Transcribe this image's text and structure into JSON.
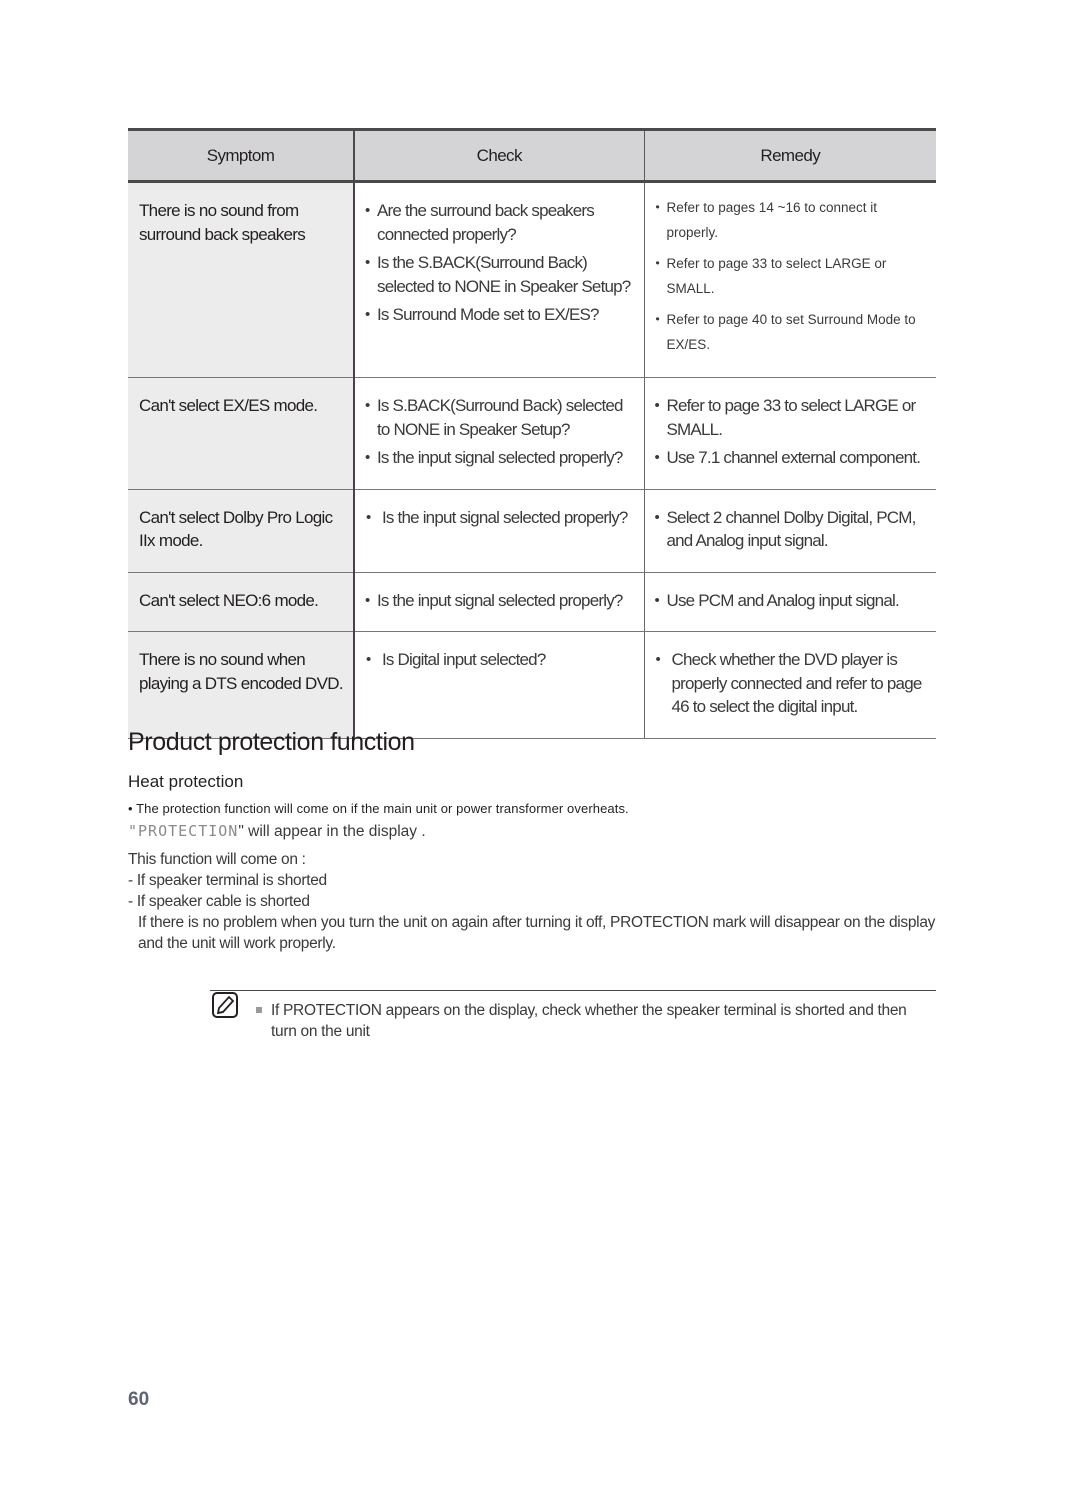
{
  "table": {
    "headers": [
      "Symptom",
      "Check",
      "Remedy"
    ],
    "rows": [
      {
        "symptom": "There is no sound from surround back speakers",
        "checks": [
          "Are the surround back speakers connected properly?",
          "Is the S.BACK(Surround Back) selected to NONE in Speaker Setup?",
          "Is Surround Mode set to EX/ES?"
        ],
        "remedies": [
          "Refer to pages 14 ~16 to connect it properly.",
          "Refer to page 33 to select LARGE or SMALL.",
          "Refer to page 40 to set Surround Mode to EX/ES."
        ]
      },
      {
        "symptom": "Can't select EX/ES mode.",
        "checks": [
          "Is S.BACK(Surround Back) selected to NONE in Speaker Setup?",
          "Is the input signal selected properly?"
        ],
        "remedies": [
          "Refer to page 33 to select LARGE or SMALL.",
          "Use 7.1 channel external component."
        ]
      },
      {
        "symptom": "Can't select Dolby Pro Logic IIx mode.",
        "checks": [
          "Is the input signal selected properly?"
        ],
        "remedies": [
          "Select 2 channel Dolby Digital, PCM, and Analog input signal."
        ]
      },
      {
        "symptom": "Can't select NEO:6 mode.",
        "checks": [
          "Is the input signal selected properly?"
        ],
        "remedies": [
          "Use PCM and Analog input signal."
        ]
      },
      {
        "symptom": "There is no sound when playing a DTS encoded DVD.",
        "checks": [
          "Is Digital input selected?"
        ],
        "remedies": [
          "Check whether the DVD player is properly connected and refer to page 46 to select the digital input."
        ]
      }
    ]
  },
  "section": {
    "title": "Product protection function",
    "subtitle": "Heat protection",
    "bullet": "The protection function will come on if the main unit or power transformer overheats.",
    "display_quote_open": "\"",
    "display_word": "PROTECTION",
    "display_rest": "\" will appear in the display .",
    "intro": "This function will come on :",
    "conditions": [
      "- If speaker terminal is shorted",
      "- If speaker cable is shorted"
    ],
    "explanation": "If there is no problem when you turn the unit on again after turning it off, PROTECTION mark will disappear on the display and the unit will work properly."
  },
  "note": {
    "icon": "note-pencil-icon",
    "text": "If PROTECTION appears on the display, check whether the speaker terminal is shorted and then turn on the unit"
  },
  "page_number": "60"
}
